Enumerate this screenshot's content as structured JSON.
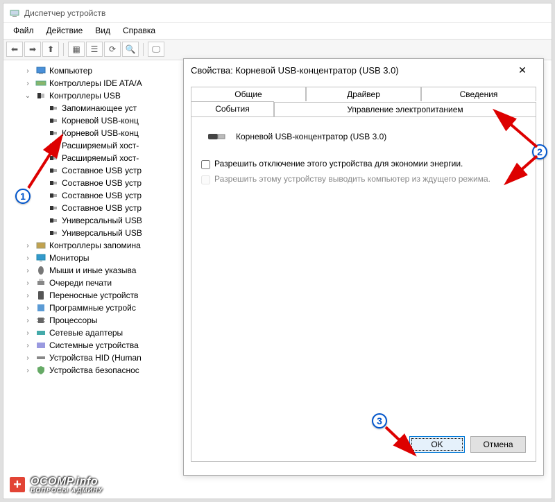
{
  "window": {
    "title": "Диспетчер устройств",
    "menus": [
      "Файл",
      "Действие",
      "Вид",
      "Справка"
    ],
    "toolbar_icons": [
      "back-icon",
      "forward-icon",
      "up-icon",
      "divider",
      "show-hidden-icon",
      "properties-icon",
      "refresh-icon",
      "scan-icon",
      "divider",
      "monitor-icon"
    ]
  },
  "tree": [
    {
      "indent": 1,
      "toggle": ">",
      "icon": "computer",
      "label": "Компьютер"
    },
    {
      "indent": 1,
      "toggle": ">",
      "icon": "ide",
      "label": "Контроллеры IDE ATA/A"
    },
    {
      "indent": 1,
      "toggle": "v",
      "icon": "usb",
      "label": "Контроллеры USB"
    },
    {
      "indent": 2,
      "toggle": "",
      "icon": "usbplug",
      "label": "Запоминающее уст"
    },
    {
      "indent": 2,
      "toggle": "",
      "icon": "usbplug",
      "label": "Корневой USB-конц"
    },
    {
      "indent": 2,
      "toggle": "",
      "icon": "usbplug",
      "label": "Корневой USB-конц"
    },
    {
      "indent": 2,
      "toggle": "",
      "icon": "usbplug",
      "label": "Расширяемый хост-"
    },
    {
      "indent": 2,
      "toggle": "",
      "icon": "usbplug",
      "label": "Расширяемый хост-"
    },
    {
      "indent": 2,
      "toggle": "",
      "icon": "usbplug",
      "label": "Составное USB устр"
    },
    {
      "indent": 2,
      "toggle": "",
      "icon": "usbplug",
      "label": "Составное USB устр"
    },
    {
      "indent": 2,
      "toggle": "",
      "icon": "usbplug",
      "label": "Составное USB устр"
    },
    {
      "indent": 2,
      "toggle": "",
      "icon": "usbplug",
      "label": "Составное USB устр"
    },
    {
      "indent": 2,
      "toggle": "",
      "icon": "usbplug",
      "label": "Универсальный USB"
    },
    {
      "indent": 2,
      "toggle": "",
      "icon": "usbplug",
      "label": "Универсальный USB"
    },
    {
      "indent": 1,
      "toggle": ">",
      "icon": "storage",
      "label": "Контроллеры запомина"
    },
    {
      "indent": 1,
      "toggle": ">",
      "icon": "monitor",
      "label": "Мониторы"
    },
    {
      "indent": 1,
      "toggle": ">",
      "icon": "mouse",
      "label": "Мыши и иные указыва"
    },
    {
      "indent": 1,
      "toggle": ">",
      "icon": "printer",
      "label": "Очереди печати"
    },
    {
      "indent": 1,
      "toggle": ">",
      "icon": "portable",
      "label": "Переносные устройств"
    },
    {
      "indent": 1,
      "toggle": ">",
      "icon": "software",
      "label": "Программные устройс"
    },
    {
      "indent": 1,
      "toggle": ">",
      "icon": "cpu",
      "label": "Процессоры"
    },
    {
      "indent": 1,
      "toggle": ">",
      "icon": "network",
      "label": "Сетевые адаптеры"
    },
    {
      "indent": 1,
      "toggle": ">",
      "icon": "system",
      "label": "Системные устройства"
    },
    {
      "indent": 1,
      "toggle": ">",
      "icon": "hid",
      "label": "Устройства HID (Human"
    },
    {
      "indent": 1,
      "toggle": ">",
      "icon": "security",
      "label": "Устройства безопаснос"
    }
  ],
  "dialog": {
    "title": "Свойства: Корневой USB-концентратор (USB 3.0)",
    "close": "✕",
    "tabs_row1": [
      "Общие",
      "Драйвер",
      "Сведения"
    ],
    "tabs_row2": [
      "События",
      "Управление электропитанием"
    ],
    "device_name": "Корневой USB-концентратор (USB 3.0)",
    "checkbox1": "Разрешить отключение этого устройства для экономии энергии.",
    "checkbox2": "Разрешить этому устройству выводить компьютер из ждущего режима.",
    "ok": "OK",
    "cancel": "Отмена"
  },
  "annotations": {
    "badge1": "1",
    "badge2": "2",
    "badge3": "3"
  },
  "watermark": {
    "line1": "OCOMP.info",
    "line2": "ВОПРОСЫ АДМИНУ"
  }
}
